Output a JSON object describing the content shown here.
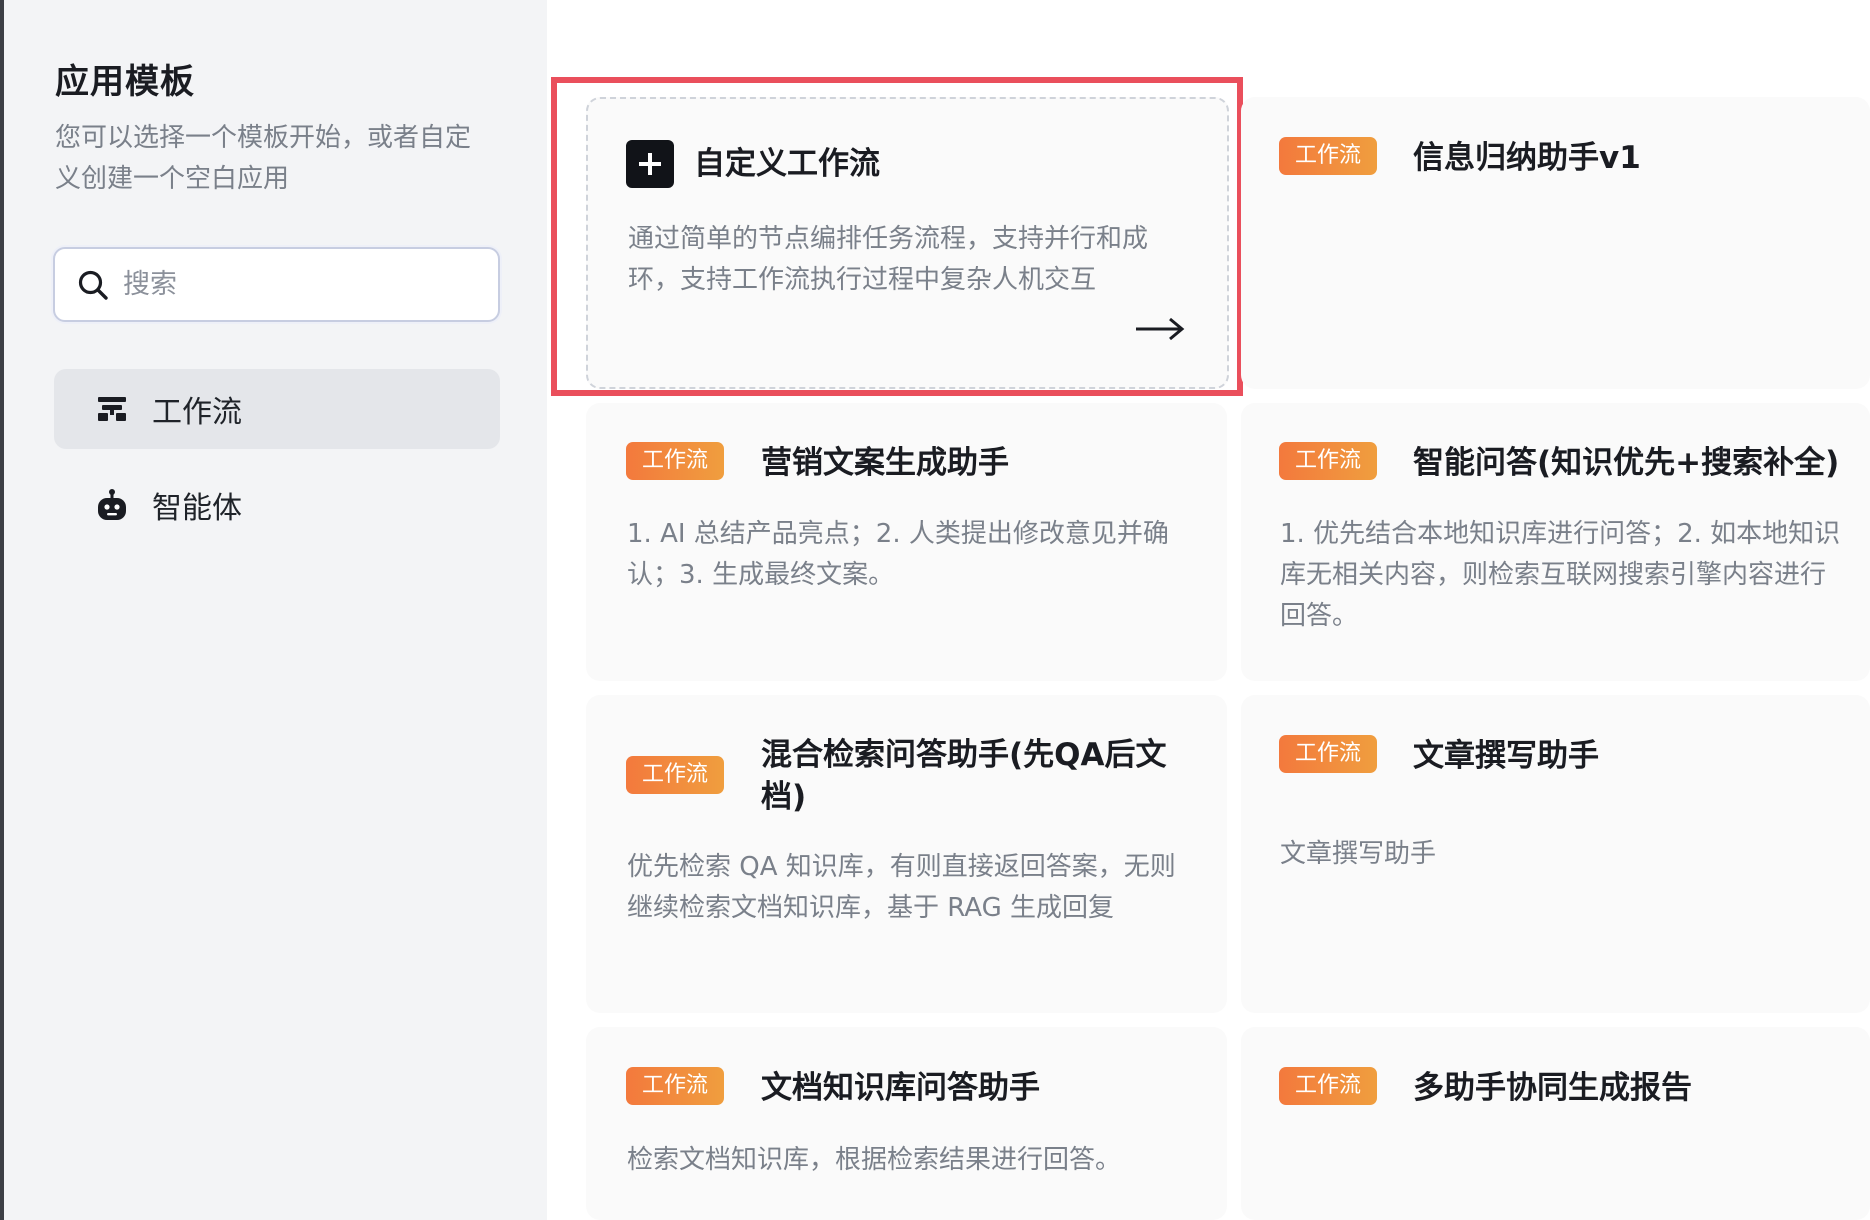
{
  "sidebar": {
    "title": "应用模板",
    "description": "您可以选择一个模板开始，或者自定义创建一个空白应用",
    "search": {
      "placeholder": "搜索",
      "value": ""
    },
    "nav": [
      {
        "label": "工作流",
        "icon": "workflow-icon",
        "active": true
      },
      {
        "label": "智能体",
        "icon": "robot-icon",
        "active": false
      }
    ]
  },
  "custom_card": {
    "title": "自定义工作流",
    "description": "通过简单的节点编排任务流程，支持并行和成环，支持工作流执行过程中复杂人机交互",
    "icon": "plus-icon",
    "arrow_icon": "arrow-right-icon"
  },
  "templates": [
    {
      "tag": "工作流",
      "title": "信息归纳助手v1",
      "description": ""
    },
    {
      "tag": "工作流",
      "title": "营销文案生成助手",
      "description": "1. AI 总结产品亮点；2. 人类提出修改意见并确认；3. 生成最终文案。"
    },
    {
      "tag": "工作流",
      "title": "智能问答(知识优先+搜索补全)",
      "description": "1. 优先结合本地知识库进行问答；2. 如本地知识库无相关内容，则检索互联网搜索引擎内容进行回答。"
    },
    {
      "tag": "工作流",
      "title": "混合检索问答助手(先QA后文档)",
      "description": "优先检索 QA 知识库，有则直接返回答案，无则继续检索文档知识库，基于 RAG 生成回复"
    },
    {
      "tag": "工作流",
      "title": "文章撰写助手",
      "description": "文章撰写助手"
    },
    {
      "tag": "工作流",
      "title": "文档知识库问答助手",
      "description": "检索文档知识库，根据检索结果进行回答。"
    },
    {
      "tag": "工作流",
      "title": "多助手协同生成报告",
      "description": ""
    }
  ],
  "colors": {
    "tag_start": "#f3793d",
    "tag_end": "#f09e3e",
    "highlight_border": "#ea4f5c",
    "sidebar_bg": "#f3f4f6",
    "active_nav_bg": "#e4e6ea"
  }
}
